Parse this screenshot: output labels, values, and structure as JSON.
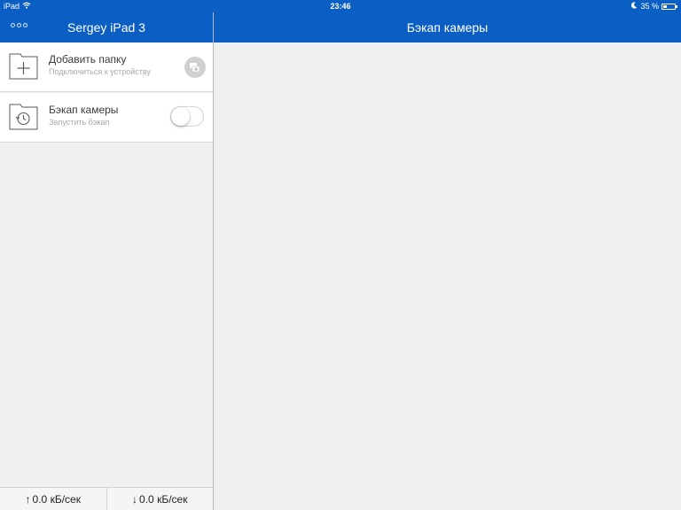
{
  "colors": {
    "accent": "#0b5fc4",
    "background": "#f0f0f0"
  },
  "status_bar": {
    "device": "iPad",
    "time": "23:46",
    "battery_text": "35 %",
    "battery_level": 0.35,
    "icons": [
      "wifi-icon",
      "moon-icon",
      "battery-icon"
    ]
  },
  "sidebar": {
    "title": "Sergey iPad 3",
    "items": [
      {
        "title": "Добавить папку",
        "subtitle": "Подключиться к устройству",
        "icon": "folder-add-icon",
        "action_icon": "connect-device-icon"
      },
      {
        "title": "Бэкап камеры",
        "subtitle": "Запустить бэкап",
        "icon": "camera-backup-icon",
        "toggle_on": false
      }
    ],
    "footer": {
      "upload": "0.0 кБ/сек",
      "download": "0.0 кБ/сек"
    }
  },
  "main": {
    "title": "Бэкап камеры"
  }
}
